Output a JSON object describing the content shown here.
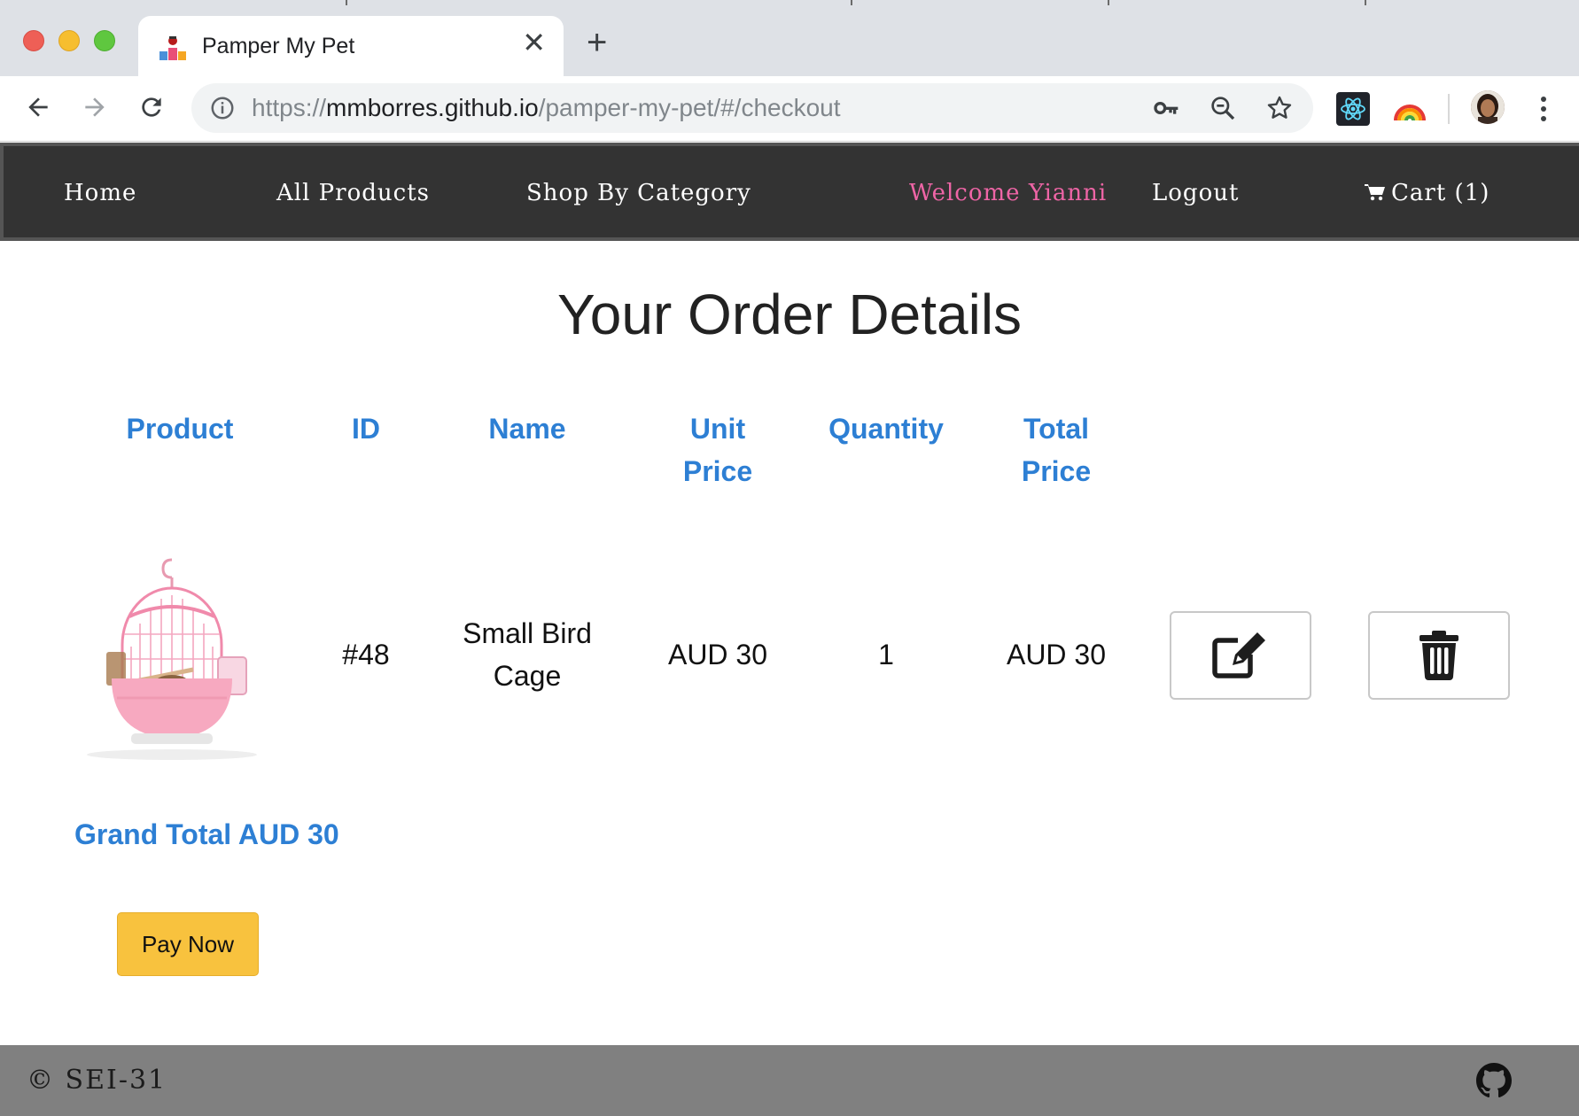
{
  "browser": {
    "tab_title": "Pamper My Pet",
    "tab_close": "✕",
    "new_tab": "+",
    "url_scheme": "https://",
    "url_host": "mmborres.github.io",
    "url_path": "/pamper-my-pet/#/checkout",
    "icons": [
      "back-icon",
      "forward-icon",
      "reload-icon",
      "info-icon",
      "key-icon",
      "zoom-out-icon",
      "star-icon",
      "react-devtools-icon",
      "rainbow-extension-icon",
      "profile-avatar",
      "more-menu-icon"
    ]
  },
  "nav": {
    "home": "Home",
    "all_products": "All Products",
    "shop_by_category": "Shop By Category",
    "welcome": "Welcome Yianni",
    "logout": "Logout",
    "cart": "Cart (1)",
    "welcome_color": "#ee65a6"
  },
  "main": {
    "title": "Your Order Details",
    "headers": {
      "product": "Product",
      "id": "ID",
      "name_col": "Name",
      "unit_price_1": "Unit",
      "unit_price_2": "Price",
      "quantity": "Quantity",
      "total_price_1": "Total",
      "total_price_2": "Price"
    },
    "row": {
      "id": "#48",
      "name_1": "Small Bird",
      "name_2": "Cage",
      "unit_price": "AUD 30",
      "quantity": "1",
      "total_price": "AUD 30"
    },
    "grand_total": "Grand Total AUD 30",
    "pay_now": "Pay Now",
    "accent_color": "#2d7fd4",
    "pay_button_color": "#f8c23e"
  },
  "footer": {
    "copyright": "© SEI-31"
  }
}
